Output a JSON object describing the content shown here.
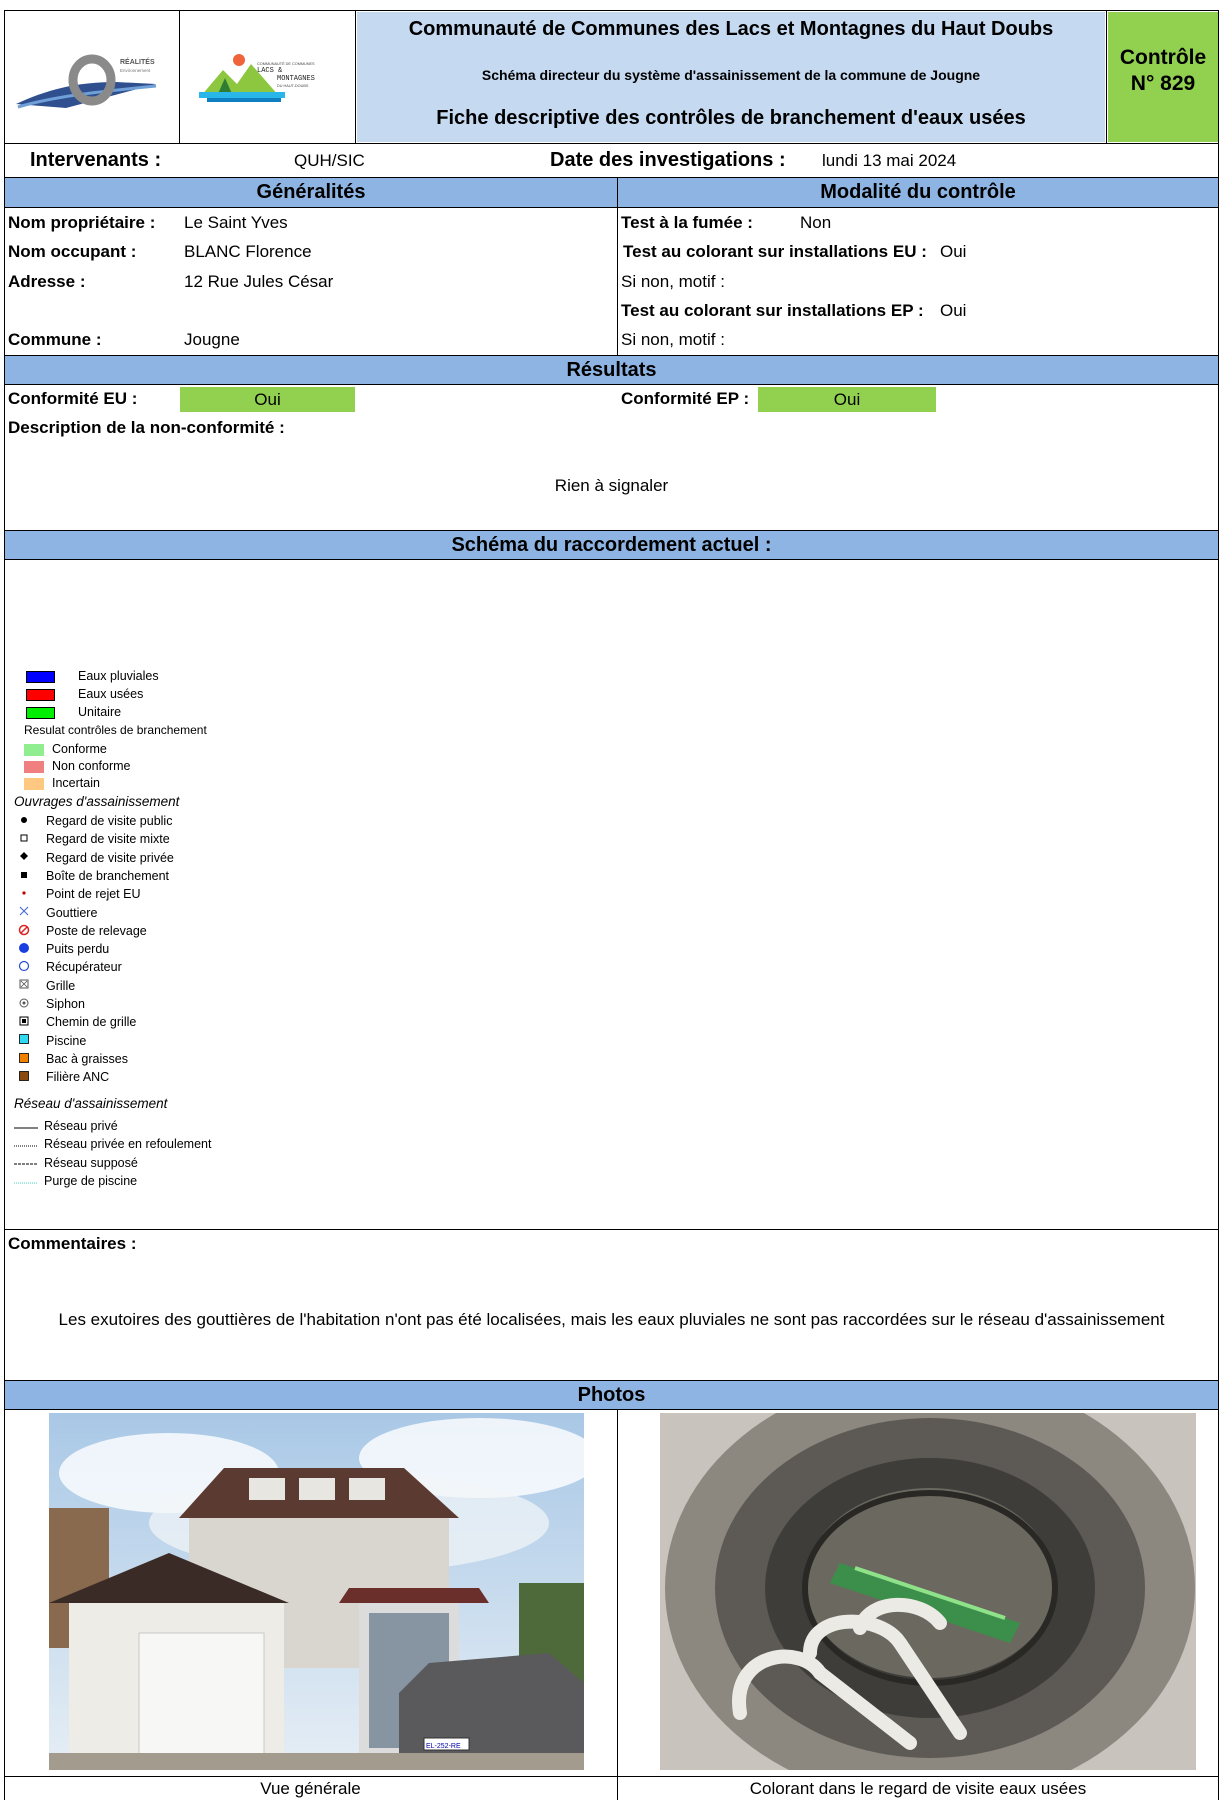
{
  "header": {
    "logo_realites": {
      "word": "RÉALITÉS",
      "sub": "Environnement"
    },
    "logo_cc": {
      "line1": "COMMUNAUTÉ DE COMMUNES",
      "line2": "LACS &",
      "line3": "MONTAGNES",
      "line4": "DU HAUT-DOUBS"
    },
    "title": "Communauté de Communes des Lacs et Montagnes du Haut Doubs",
    "subtitle": "Schéma directeur du système d'assainissement de la commune de Jougne",
    "doc_title": "Fiche descriptive des contrôles de branchement d'eaux usées",
    "control_label": "Contrôle",
    "control_number": "N° 829",
    "accent_blue": "#c5d9f1",
    "accent_green": "#92d050"
  },
  "intervenants": {
    "label": "Intervenants :",
    "value": "QUH/SIC",
    "date_label": "Date des investigations :",
    "date_value": "lundi 13 mai 2024"
  },
  "generalites": {
    "title": "Généralités",
    "proprietaire_label": "Nom propriétaire :",
    "proprietaire": "Le Saint Yves",
    "occupant_label": "Nom occupant :",
    "occupant": "BLANC Florence",
    "adresse_label": "Adresse :",
    "adresse": "12 Rue Jules César",
    "commune_label": "Commune :",
    "commune": "Jougne"
  },
  "modalite": {
    "title": "Modalité du contrôle",
    "fumee_label": "Test à la fumée :",
    "fumee": "Non",
    "eu_label": "Test au colorant sur installations EU :",
    "eu": "Oui",
    "motif1": "Si non, motif :",
    "ep_label": "Test au colorant sur installations EP :",
    "ep": "Oui",
    "motif2": "Si non, motif :"
  },
  "resultats": {
    "title": "Résultats",
    "eu_label": "Conformité EU :",
    "eu": "Oui",
    "ep_label": "Conformité EP :",
    "ep": "Oui",
    "desc_label": "Description de la non-conformité :",
    "desc": "Rien à signaler"
  },
  "schema": {
    "title": "Schéma du raccordement actuel :",
    "legend": {
      "colors": [
        "Eaux pluviales",
        "Eaux usées",
        "Unitaire"
      ],
      "results_title": "Resulat contrôles de branchement",
      "results": [
        "Conforme",
        "Non conforme",
        "Incertain"
      ],
      "ouvrages_title": "Ouvrages d'assainissement",
      "ouvrages": [
        "Regard de visite public",
        "Regard de visite mixte",
        "Regard de visite privée",
        "Boîte de branchement",
        "Point de rejet EU",
        "Gouttiere",
        "Poste de relevage",
        "Puits perdu",
        "Récupérateur",
        "Grille",
        "Siphon",
        "Chemin de grille",
        "Piscine",
        "Bac à graisses",
        "Filière ANC"
      ],
      "reseau_title": "Réseau d'assainissement",
      "reseau": [
        "Réseau privé",
        "Réseau privée en refoulement",
        "Réseau supposé",
        "Purge de piscine"
      ]
    }
  },
  "commentaires": {
    "label": "Commentaires :",
    "text": "Les exutoires des gouttières de l'habitation n'ont pas été localisées, mais les eaux pluviales ne sont pas raccordées sur le réseau d'assainissement"
  },
  "photos": {
    "title": "Photos",
    "caption1": "Vue générale",
    "caption2": "Colorant dans le regard de visite eaux usées",
    "plate": "EL-252-RE"
  }
}
